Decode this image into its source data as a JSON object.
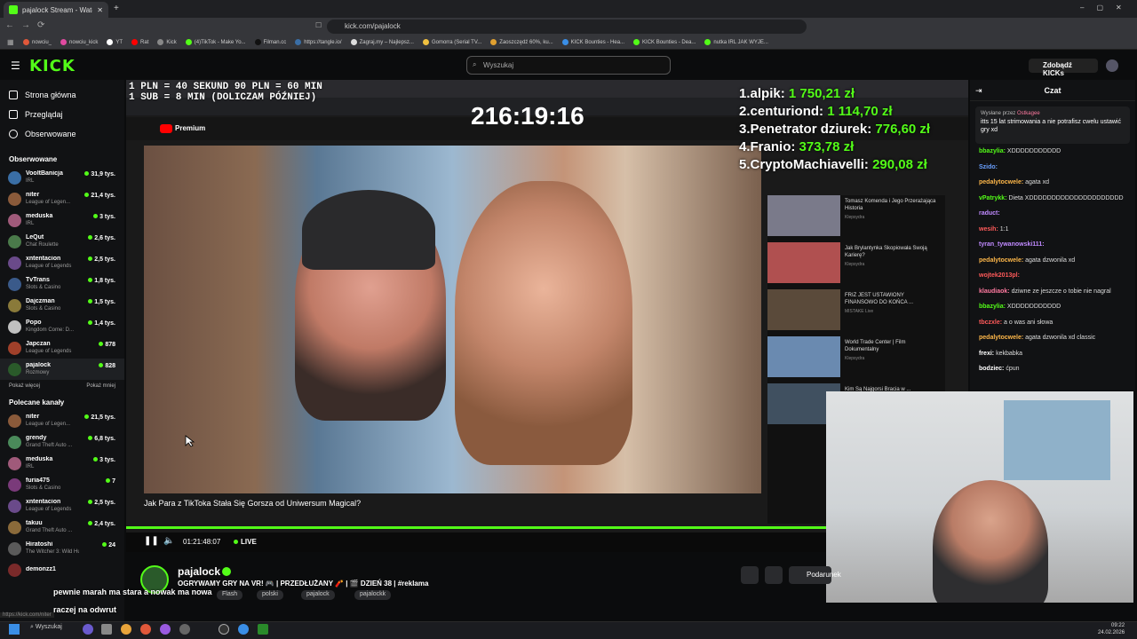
{
  "browser": {
    "tab_title": "pajalock Stream - Watch Liv",
    "url": "kick.com/pajalock",
    "bookmarks": [
      "nowciu_",
      "nowciu_kick",
      "YT",
      "Rat",
      "Kick",
      "(4)TikTok - Make Yo...",
      "Filman.cc",
      "https://tangle.io/",
      "Zagraj.my – Najlepsz...",
      "Gomorra (Serial TV...",
      "Zaoszczędź 60%, ku...",
      "KICK Bounties - Hea...",
      "KICK Bounties - Dea...",
      "nutka IRL JAK WYJE..."
    ]
  },
  "header": {
    "logo": "KICK",
    "search_placeholder": "Wyszukaj",
    "kicks_button": "Zdobądź KICKs"
  },
  "nav": [
    {
      "label": "Strona główna",
      "icon": "home-icon"
    },
    {
      "label": "Przeglądaj",
      "icon": "browse-icon"
    },
    {
      "label": "Obserwowane",
      "icon": "heart-icon"
    }
  ],
  "followed": {
    "title": "Obserwowane",
    "channels": [
      {
        "name": "VooltBanicja",
        "category": "IRL",
        "viewers": "31,9 tys.",
        "color": "#3a6ea5"
      },
      {
        "name": "niter",
        "category": "League of Legen...",
        "viewers": "21,4 tys.",
        "color": "#8a5a3a"
      },
      {
        "name": "meduska",
        "category": "IRL",
        "viewers": "3 tys.",
        "color": "#a05a7a"
      },
      {
        "name": "LeQut",
        "category": "Chat Roulette",
        "viewers": "2,6 tys.",
        "color": "#4a7a4a"
      },
      {
        "name": "xntentacion",
        "category": "League of Legends",
        "viewers": "2,5 tys.",
        "color": "#6a4a8a"
      },
      {
        "name": "TvTrans",
        "category": "Slots & Casino",
        "viewers": "1,8 tys.",
        "color": "#3a5a8a"
      },
      {
        "name": "Dajczman",
        "category": "Slots & Casino",
        "viewers": "1,5 tys.",
        "color": "#8a7a3a"
      },
      {
        "name": "Popo",
        "category": "Kingdom Come: D...",
        "viewers": "1,4 tys.",
        "color": "#c0c0c0"
      },
      {
        "name": "Japczan",
        "category": "League of Legends",
        "viewers": "878",
        "color": "#a0402a"
      },
      {
        "name": "pajalock",
        "category": "Rozmowy",
        "viewers": "828",
        "color": "#2a5a2a"
      }
    ],
    "show_more": "Pokaż więcej",
    "show_less": "Pokaż mniej"
  },
  "recommended": {
    "title": "Polecane kanały",
    "channels": [
      {
        "name": "niter",
        "category": "League of Legen...",
        "viewers": "21,5 tys.",
        "color": "#8a5a3a"
      },
      {
        "name": "grendy",
        "category": "Grand Theft Auto ...",
        "viewers": "6,8 tys.",
        "color": "#4a8a5a"
      },
      {
        "name": "meduska",
        "category": "IRL",
        "viewers": "3 tys.",
        "color": "#a05a7a"
      },
      {
        "name": "furia475",
        "category": "Slots & Casino",
        "viewers": "7",
        "color": "#7a3a7a"
      },
      {
        "name": "xntentacion",
        "category": "League of Legends",
        "viewers": "2,5 tys.",
        "color": "#6a4a8a"
      },
      {
        "name": "takuu",
        "category": "Grand Theft Auto ...",
        "viewers": "2,4 tys.",
        "color": "#8a6a3a"
      },
      {
        "name": "Hiratoshi",
        "category": "The Witcher 3: Wild Hunt",
        "viewers": "24",
        "color": "#5a5a5a"
      },
      {
        "name": "demonzz1",
        "category": "",
        "viewers": "",
        "color": "#7a2a2a"
      }
    ]
  },
  "video": {
    "timer": "216:19:16",
    "pricing_line1": "1 PLN = 40 SEKUND 90 PLN = 60 MIN",
    "pricing_line2": "1 SUB = 8 MIN (DOLICZAM PÓŹNIEJ)",
    "leaderboard": [
      {
        "rank": "1.",
        "name": "alpik:",
        "amount": "1 750,21 zł"
      },
      {
        "rank": "2.",
        "name": "centuriond:",
        "amount": "1 114,70 zł"
      },
      {
        "rank": "3.",
        "name": "Penetrator dziurek:",
        "amount": "776,60 zł"
      },
      {
        "rank": "4.",
        "name": "Franio:",
        "amount": "373,78 zł"
      },
      {
        "rank": "5.",
        "name": "CryptoMachiavelli:",
        "amount": "290,08 zł"
      }
    ],
    "yt_title": "Jak Para z TikToka Stała Się Gorsza od Uniwersum Magical?",
    "yt_logo": "Premium",
    "suggestions": [
      {
        "title": "Tomasz Komenda i Jego Przerażająca Historia",
        "sub": "Klepsydra"
      },
      {
        "title": "Jak Brylantynka Skopiowała Swoją Karierę?",
        "sub": "Klepsydra"
      },
      {
        "title": "FRIZ JEST USTAWIONY FINANSOWO DO KOŃCA ...",
        "sub": "MISTAKE Live"
      },
      {
        "title": "World Trade Center | Film Dokumentalny",
        "sub": "Klepsydra"
      },
      {
        "title": "Kim Są Najgorsi Bracia w ...",
        "sub": "Klepsydra"
      }
    ],
    "elapsed": "01:21:48:07",
    "live_label": "LIVE"
  },
  "chat": {
    "title": "Czat",
    "pinned_by": "Wysłane przez",
    "pinned_user": "Ostkagee",
    "pinned_text": "itts 15 lat strimowania a nie potrafisz cwelu ustawić gry xd",
    "messages": [
      {
        "user": "bbazylia:",
        "text": "XDDDDDDDDDDD",
        "color": "#53fc18"
      },
      {
        "user": "Szido:",
        "text": "",
        "color": "#6aa0ff"
      },
      {
        "user": "pedalytocwele:",
        "text": "agata xd",
        "color": "#ffb84a"
      },
      {
        "user": "vPatrykk:",
        "text": "Dieta XDDDDDDDDDDDDDDDDDDDDD",
        "color": "#53fc18"
      },
      {
        "user": "raduct:",
        "text": "",
        "color": "#c08aff"
      },
      {
        "user": "wesih:",
        "text": "1:1",
        "color": "#ff5a5a"
      },
      {
        "user": "tyran_tywanowski111:",
        "text": "",
        "color": "#c08aff"
      },
      {
        "user": "pedalytocwele:",
        "text": "agata dzwonila xd",
        "color": "#ffb84a"
      },
      {
        "user": "wojtek2013pl:",
        "text": "",
        "color": "#ff5a5a"
      },
      {
        "user": "klaudiaok:",
        "text": "dziwne ze jeszcze o tobie nie nagral",
        "color": "#ff7aa0"
      },
      {
        "user": "bbazylia:",
        "text": "XDDDDDDDDDDD",
        "color": "#53fc18"
      },
      {
        "user": "tbczxle:",
        "text": "a o was ani słowa",
        "color": "#ff5a5a"
      },
      {
        "user": "pedalytocwele:",
        "text": "agata dzwonila xd classic",
        "color": "#ffb84a"
      },
      {
        "user": "frexi:",
        "text": "kekbabka",
        "color": "#ffffff"
      },
      {
        "user": "bodziec:",
        "text": "ćpun",
        "color": "#ffffff"
      }
    ]
  },
  "stream": {
    "streamer": "pajalock",
    "title": "OGRYWAMY GRY NA VR! 🎮 | PRZEDŁUŻANY 🧨 | 🎬 DZIEŃ 38 | #reklama",
    "tags": [
      "Flash",
      "polski",
      "pajalock",
      "pajalockk"
    ],
    "gift_label": "Podarunek",
    "overlay_line1": "pewnie marah ma stara a nowak ma nowa",
    "overlay_line2": "raczej na odwrut",
    "status_url": "https://kick.com/niter"
  },
  "taskbar": {
    "search": "Wyszukaj",
    "time": "09:22",
    "date": "24.02.2026"
  }
}
